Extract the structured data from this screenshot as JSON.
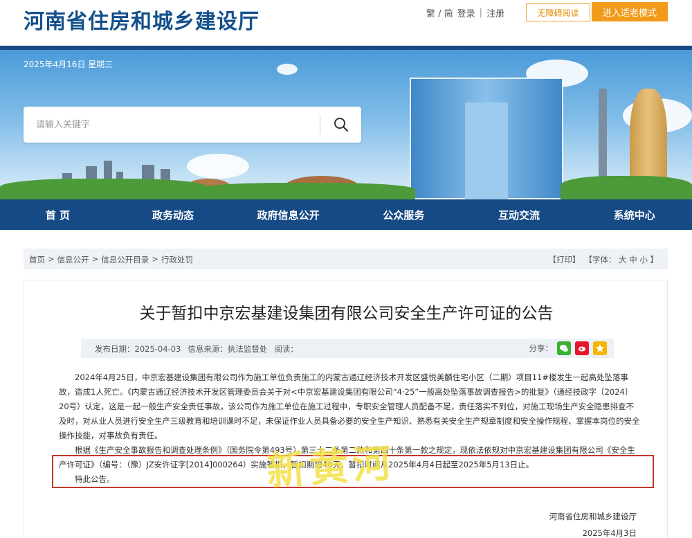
{
  "header": {
    "site_title": "河南省住房和城乡建设厅",
    "lang_toggle": "繁 / 简",
    "login": "登录",
    "register": "注册",
    "accessible_reading": "无障碍阅读",
    "elder_mode": "进入适老模式"
  },
  "banner": {
    "date": "2025年4月16日 星期三",
    "search_placeholder": "请输入关键字"
  },
  "nav": {
    "items": [
      "首 页",
      "政务动态",
      "政府信息公开",
      "公众服务",
      "互动交流",
      "系统中心"
    ]
  },
  "breadcrumb": {
    "items": [
      "首页",
      "信息公开",
      "信息公开目录",
      "行政处罚"
    ],
    "separator": ">",
    "print": "【打印】",
    "font_label": "【字体：",
    "font_large": "大",
    "font_medium": "中",
    "font_small": "小",
    "font_close": "】"
  },
  "article": {
    "title": "关于暂扣中京宏基建设集团有限公司安全生产许可证的公告",
    "publish_date": "发布日期：2025-04-03",
    "source": "信息来源：执法监督处",
    "reads": "阅读：",
    "share_label": "分享：",
    "paragraphs": [
      "2024年4月25日，中京宏基建设集团有限公司作为施工单位负责施工的内蒙古通辽经济技术开发区盛悦美麟住宅小区（二期）项目11#楼发生一起高处坠落事故，造成1人死亡。《内蒙古通辽经济技术开发区管理委员会关于对<中京宏基建设集团有限公司“4·25”一般高处坠落事故调查报告>的批复》（通经技政字〔2024〕20号）认定，这是一起一般生产安全责任事故，该公司作为施工单位在施工过程中，专职安全管理人员配备不足，责任落实不到位，对施工现场生产安全隐患排查不及时，对从业人员进行安全生产三级教育和培训课时不足，未保证作业人员具备必要的安全生产知识、熟悉有关安全生产规章制度和安全操作规程、掌握本岗位的安全操作技能，对事故负有责任。",
      "根据《生产安全事故报告和调查处理条例》（国务院令第493号）第三十二条第二款和第四十条第一款之规定，现依法依规对中京宏基建设集团有限公司《安全生产许可证》（编号：（豫）JZ安许证字[2014]000264）实施暂扣，暂扣期限40天，暂扣时间从2025年4月4日起至2025年5月13日止。",
      "特此公告。"
    ],
    "sign_org": "河南省住房和城乡建设厅",
    "sign_date": "2025年4月3日"
  },
  "watermark": "新黄河",
  "colors": {
    "brand_blue": "#164a84",
    "accent_orange": "#f29b1a",
    "highlight_red": "#c0392b"
  }
}
